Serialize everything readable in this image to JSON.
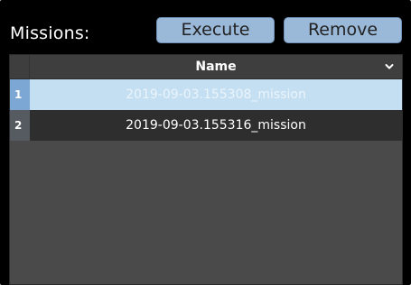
{
  "panel": {
    "title": "Missions:",
    "execute_label": "Execute",
    "remove_label": "Remove"
  },
  "table": {
    "columns": [
      {
        "label": "Name",
        "icon": "chevron-down-icon"
      }
    ],
    "rows": [
      {
        "index": "1",
        "name": "2019-09-03.155308_mission",
        "selected": true
      },
      {
        "index": "2",
        "name": "2019-09-03.155316_mission",
        "selected": false
      }
    ]
  },
  "colors": {
    "button_fill": "#9ab8d8",
    "selected_row": "#c5dff2",
    "selected_index": "#7ca7d4",
    "table_background": "#4a4a4a"
  }
}
